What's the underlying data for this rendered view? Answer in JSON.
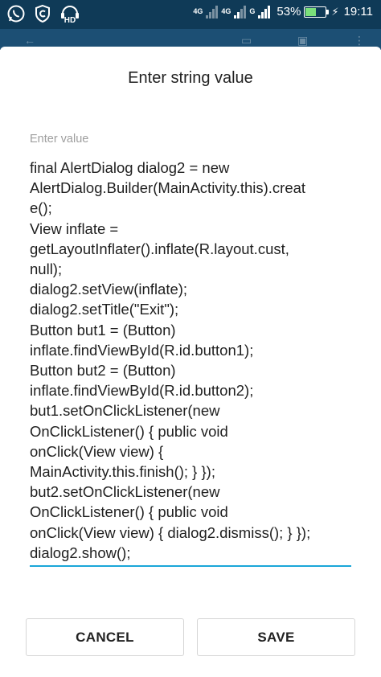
{
  "status_bar": {
    "network_4g_label_1": "4G",
    "network_4g_label_2": "4G",
    "network_g_label": "G",
    "battery_percent": "53%",
    "battery_level": 0.53,
    "time": "19:11",
    "left_icons": [
      "whatsapp-icon",
      "vpn-shield-icon",
      "hd-voice-icon"
    ],
    "hd_text": "HD"
  },
  "dialog": {
    "title": "Enter string value",
    "hint": "Enter value",
    "value_lines": [
      "final AlertDialog dialog2 = new",
      "AlertDialog.Builder(MainActivity.this).creat",
      "e();",
      "View inflate =",
      "getLayoutInflater().inflate(R.layout.cust,",
      "null);",
      "dialog2.setView(inflate);",
      "dialog2.setTitle(\"Exit\");",
      "Button but1 = (Button)",
      "inflate.findViewById(R.id.button1);",
      "Button but2 = (Button)",
      "inflate.findViewById(R.id.button2);",
      "but1.setOnClickListener(new",
      "OnClickListener() { public void",
      "onClick(View view) {",
      "MainActivity.this.finish(); } });",
      "but2.setOnClickListener(new",
      "OnClickListener() { public void",
      "onClick(View view) { dialog2.dismiss(); } });",
      "dialog2.show();"
    ],
    "cancel_label": "CANCEL",
    "save_label": "SAVE"
  },
  "colors": {
    "status_bar_bg": "#0f3a57",
    "underline_accent": "#1aa6d8",
    "battery_fill": "#7be07b"
  }
}
